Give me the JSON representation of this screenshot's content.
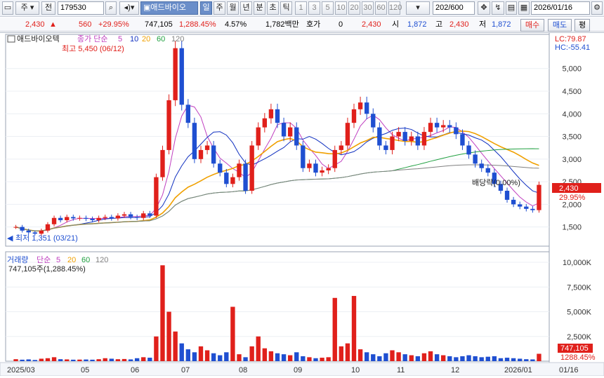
{
  "toolbar": {
    "market": "주",
    "jeon_label": "전",
    "code": "179530",
    "stock_name": "애드바이오",
    "period_tabs": [
      "일",
      "주",
      "월",
      "년",
      "분",
      "초",
      "틱"
    ],
    "active_period": "일",
    "intervals": [
      "1",
      "3",
      "5",
      "10",
      "20",
      "30",
      "60",
      "120"
    ],
    "count_value": "202",
    "count_total": "/600",
    "date": "2026/01/16"
  },
  "quote": {
    "price": "2,430",
    "change": "560",
    "change_pct": "+29.95%",
    "volume": "747,105",
    "volume_pct": "1,288.45%",
    "turnover_pct": "4.57%",
    "amount": "1,782백만",
    "hoga_label": "호가",
    "hoga_value": "0",
    "hoga_price": "2,430",
    "open_label": "시",
    "open": "1,872",
    "high_label": "고",
    "high": "2,430",
    "low_label": "저",
    "low": "1,872",
    "buy_label": "매수",
    "sell_label": "매도",
    "extra_label": "평"
  },
  "price_panel": {
    "name_label": "애드바이오텍",
    "ma_label": "종가 단순",
    "ma_periods": [
      "5",
      "10",
      "20",
      "60",
      "120"
    ],
    "lc": "LC:79.87",
    "hc": "HC:-55.41",
    "high_marker": "최고 5,450 (06/12)",
    "low_marker": "최저 1,351 (03/21)",
    "ex_rights": "배당락(0.00%)",
    "last_price_tag": "2,430",
    "last_pct_tag": "29.95%",
    "y_ticks": [
      "5,000",
      "4,500",
      "4,000",
      "3,500",
      "3,000",
      "2,500",
      "2,000",
      "1,500"
    ]
  },
  "volume_panel": {
    "title": "거래량",
    "ma_label": "단순",
    "ma_periods": [
      "5",
      "20",
      "60",
      "120"
    ],
    "current": "747,105주(1,288.45%)",
    "last_tag": "747,105",
    "last_pct_tag": "1288.45%",
    "y_ticks": [
      "10,000K",
      "7,500K",
      "5,000K",
      "2,500K"
    ]
  },
  "x_axis": [
    "2025/03",
    "05",
    "06",
    "07",
    "08",
    "09",
    "10",
    "11",
    "12",
    "2026/01",
    "01/16"
  ],
  "colors": {
    "up": "#e0201b",
    "down": "#1f4fd1",
    "ma5": "#c040c0",
    "ma10": "#1030c0",
    "ma20": "#f0a000",
    "ma60": "#20a040",
    "ma120": "#808080"
  },
  "chart_data": {
    "type": "candlestick",
    "series_close": [
      1500,
      1420,
      1380,
      1351,
      1420,
      1560,
      1700,
      1650,
      1720,
      1690,
      1700,
      1680,
      1650,
      1700,
      1720,
      1690,
      1750,
      1780,
      1720,
      1700,
      1800,
      1750,
      2600,
      3200,
      4300,
      5450,
      4200,
      3800,
      3000,
      3200,
      3300,
      2900,
      2700,
      2450,
      2600,
      2900,
      2300,
      3300,
      3700,
      3900,
      4100,
      3800,
      3500,
      3700,
      3300,
      2800,
      2900,
      2700,
      2750,
      2800,
      3200,
      3300,
      3800,
      4100,
      4250,
      4000,
      3700,
      3300,
      3200,
      3500,
      3600,
      3400,
      3500,
      3300,
      3600,
      3800,
      3700,
      3750,
      3700,
      3550,
      3300,
      3100,
      2900,
      2800,
      2700,
      2450,
      2300,
      2100,
      2000,
      1950,
      1900,
      1872,
      2430
    ],
    "volume_k": [
      200,
      150,
      180,
      120,
      250,
      300,
      400,
      200,
      180,
      150,
      160,
      170,
      150,
      200,
      300,
      250,
      200,
      220,
      180,
      300,
      400,
      350,
      2500,
      9700,
      5000,
      3000,
      1800,
      1200,
      900,
      1500,
      1100,
      800,
      600,
      900,
      5500,
      700,
      400,
      1500,
      2500,
      1300,
      1000,
      800,
      700,
      600,
      900,
      500,
      400,
      300,
      350,
      400,
      6400,
      1500,
      1800,
      6600,
      1200,
      900,
      700,
      500,
      800,
      1100,
      900,
      700,
      600,
      500,
      800,
      1000,
      700,
      600,
      500,
      400,
      500,
      600,
      500,
      400,
      450,
      500,
      300,
      350,
      300,
      250,
      200,
      180,
      747
    ],
    "ylim_price": [
      1200,
      5600
    ],
    "ylim_volume_k": [
      0,
      10500
    ]
  }
}
